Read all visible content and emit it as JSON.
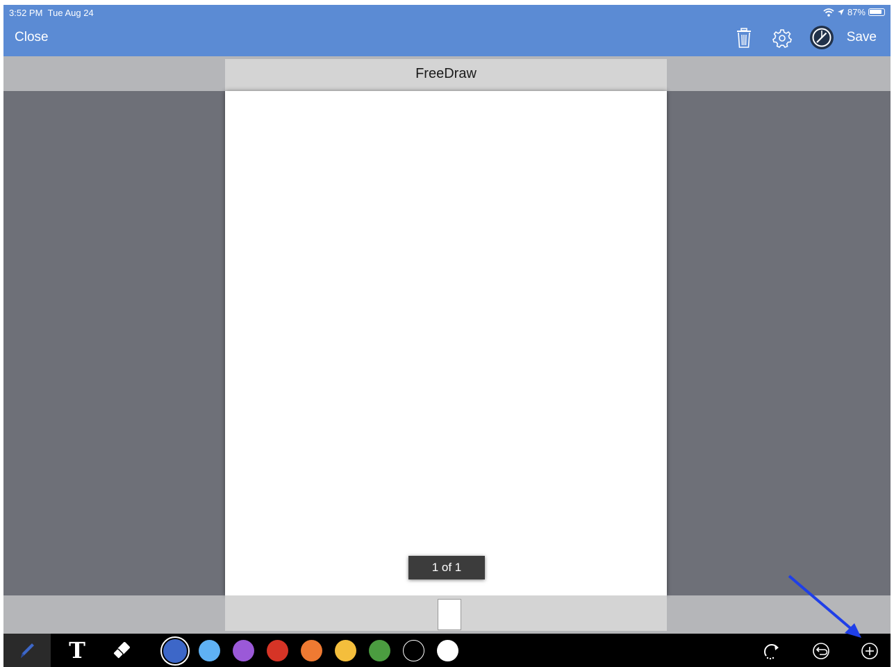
{
  "status_bar": {
    "time": "3:52 PM",
    "date": "Tue Aug 24",
    "battery": "87%",
    "icons": [
      "wifi-icon",
      "location-icon",
      "battery-icon"
    ]
  },
  "nav_bar": {
    "close_label": "Close",
    "save_label": "Save",
    "icons": [
      "trash-icon",
      "gear-icon",
      "compass-icon"
    ]
  },
  "document": {
    "title": "FreeDraw",
    "page_indicator": "1 of 1"
  },
  "toolbar": {
    "tools": [
      "pen-icon",
      "text-tool",
      "eraser-icon"
    ],
    "text_tool_glyph": "T",
    "colors": [
      "#3d67c8",
      "#5fb1f4",
      "#9b59d8",
      "#d63426",
      "#ef7a32",
      "#f4be3c",
      "#4b9c40",
      "#000000",
      "#ffffff"
    ],
    "selected_color": "#3d67c8",
    "right_icons": [
      "redo-icon",
      "undo-icon",
      "add-page-icon"
    ]
  },
  "annotation": {
    "arrow_color": "#1f3fe8"
  }
}
